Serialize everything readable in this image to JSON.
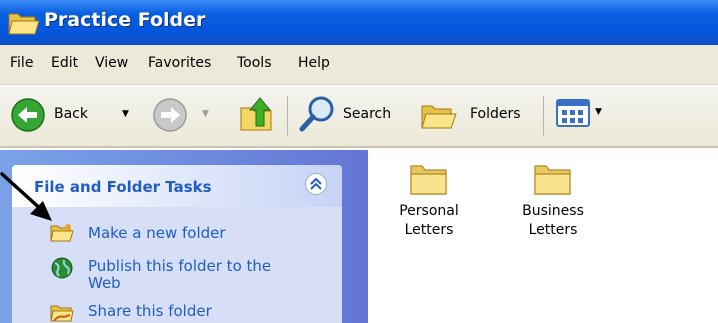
{
  "window": {
    "title": "Practice Folder"
  },
  "menu": {
    "items": [
      "File",
      "Edit",
      "View",
      "Favorites",
      "Tools",
      "Help"
    ]
  },
  "toolbar": {
    "back_label": "Back",
    "search_label": "Search",
    "folders_label": "Folders"
  },
  "task_panel": {
    "title": "File and Folder Tasks",
    "items": [
      {
        "label_line1": "Make a new folder",
        "label_line2": ""
      },
      {
        "label_line1": "Publish this folder to the",
        "label_line2": "Web"
      },
      {
        "label_line1": "Share this folder",
        "label_line2": ""
      }
    ]
  },
  "files": [
    {
      "line1": "Personal",
      "line2": "Letters"
    },
    {
      "line1": "Business",
      "line2": "Letters"
    }
  ],
  "colors": {
    "titlebar": "#0456dc",
    "task_link": "#215dc6",
    "task_panel_bg": "#d6dff7",
    "folder_fill": "#f9e38e"
  },
  "icons": {
    "title": "folder-open-icon",
    "back": "back-arrow-icon",
    "forward": "forward-arrow-icon",
    "up": "up-folder-icon",
    "search": "search-icon",
    "folders": "folders-icon",
    "views": "views-icon",
    "collapse": "chevron-up-icon",
    "new_folder": "new-folder-icon",
    "publish": "publish-web-icon",
    "share": "share-folder-icon",
    "pointer": "arrow-pointer-icon"
  }
}
